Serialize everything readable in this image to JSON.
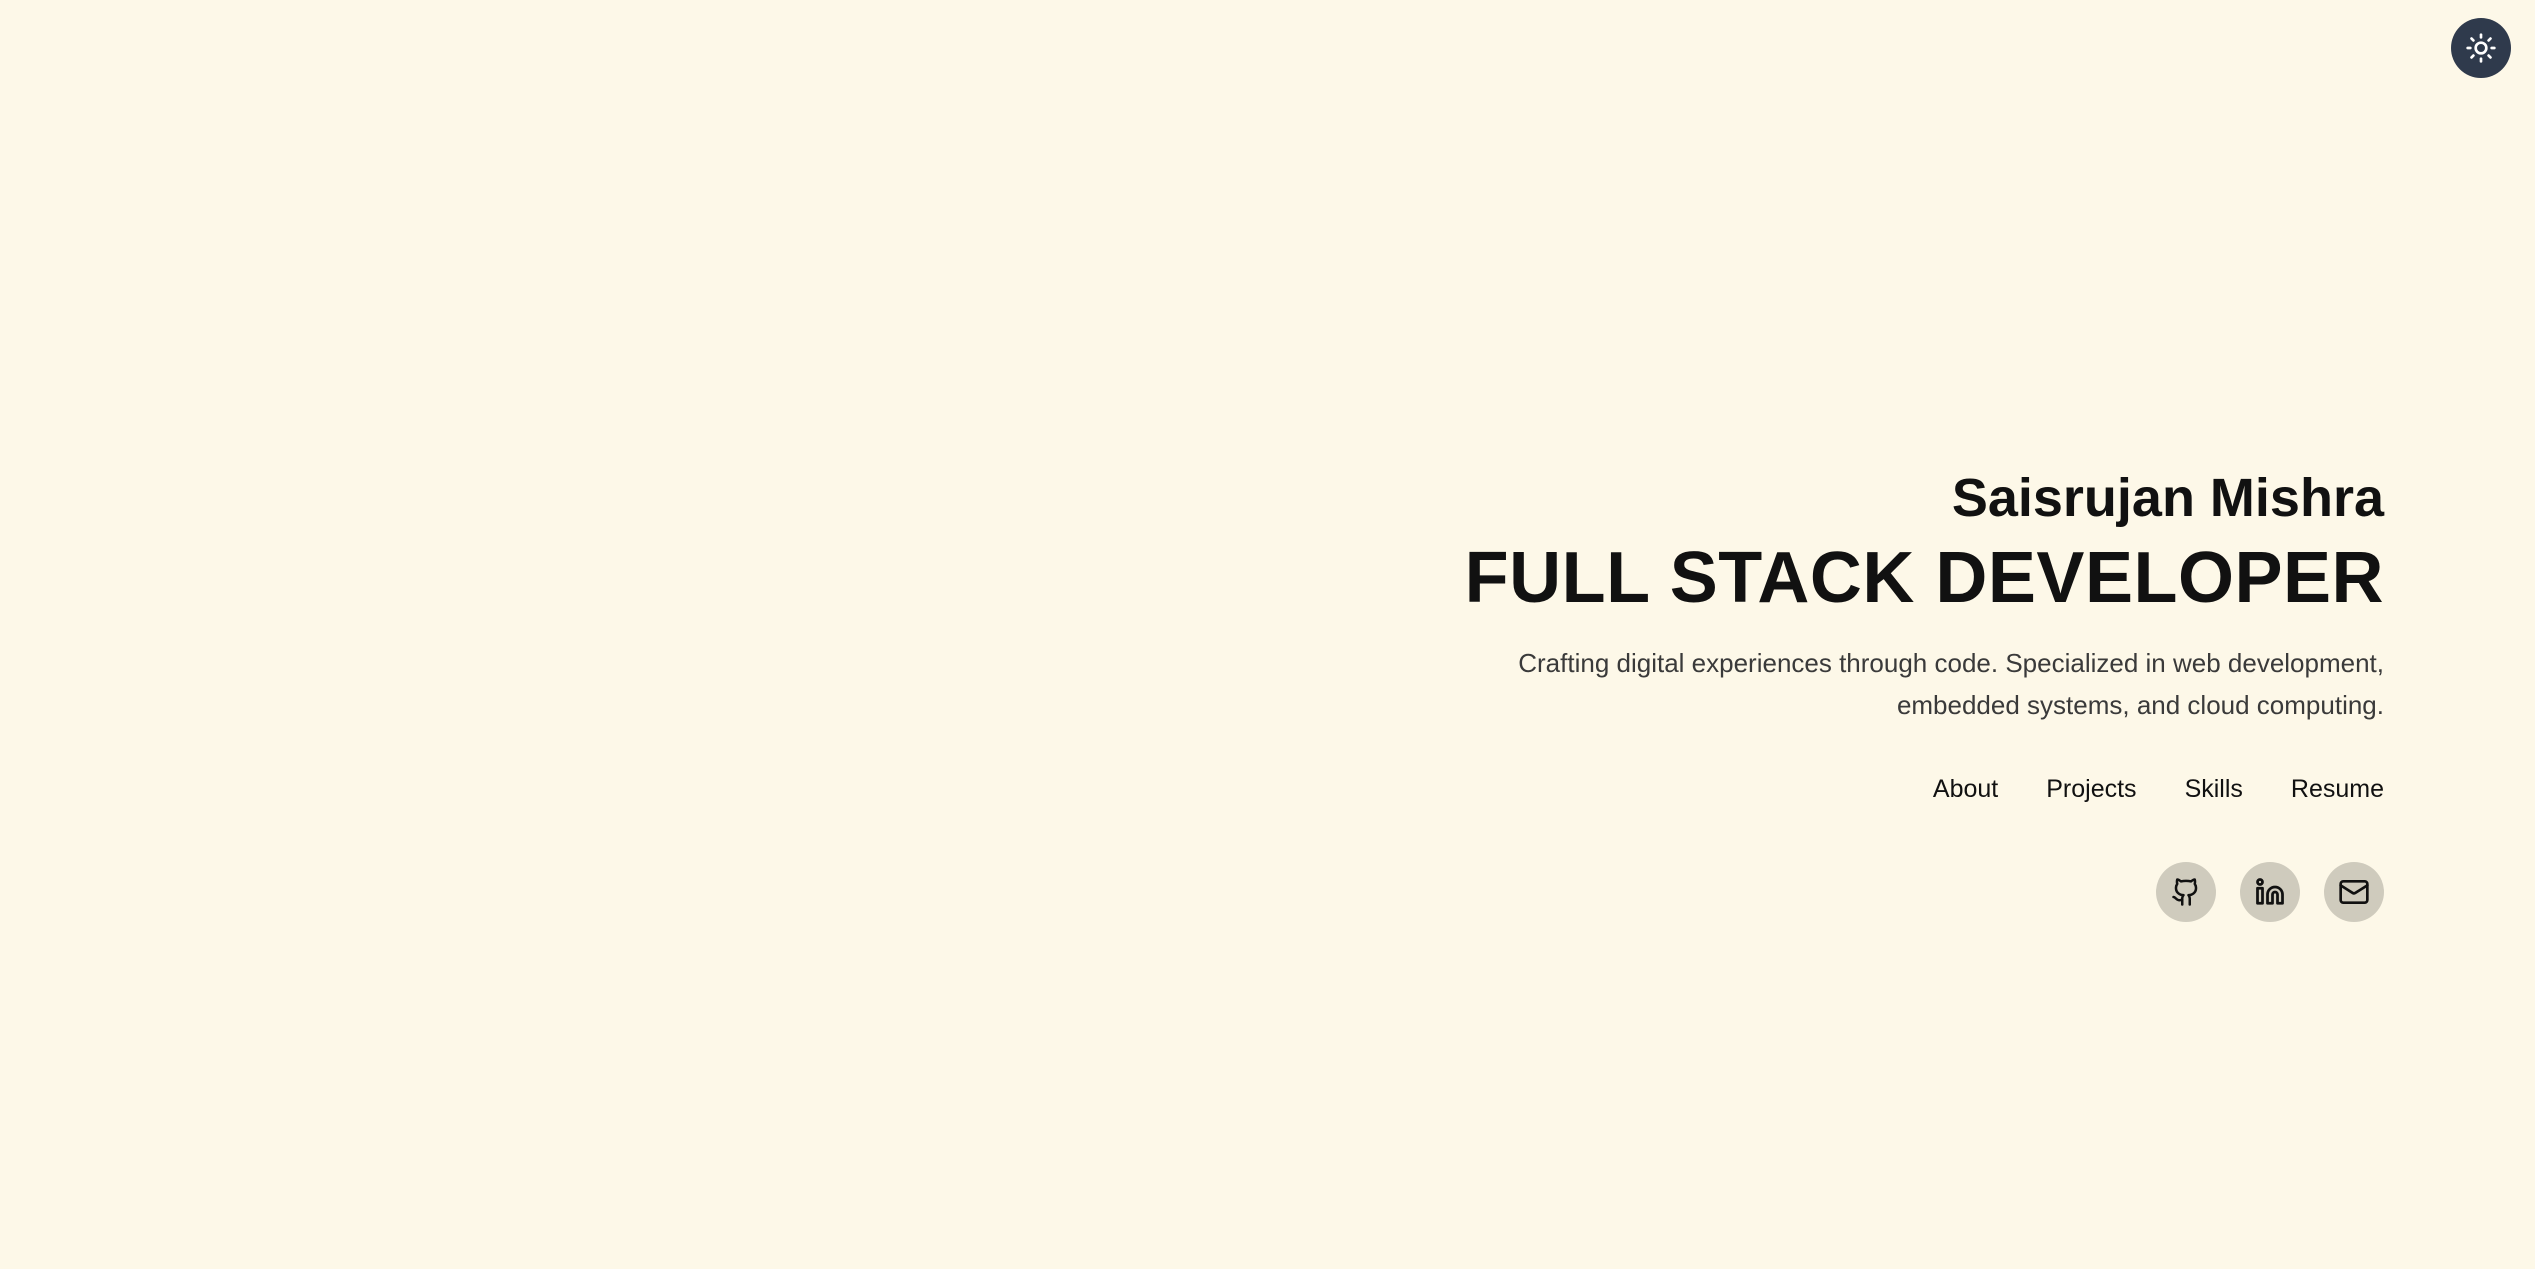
{
  "theme_toggle": {
    "icon": "sun-icon",
    "background": "#2f3a4c"
  },
  "hero": {
    "name": "Saisrujan Mishra",
    "role": "FULL STACK DEVELOPER",
    "tagline_line1": "Crafting digital experiences through code. Specialized in web development,",
    "tagline_line2": "embedded systems, and cloud computing."
  },
  "nav": {
    "items": [
      {
        "label": "About"
      },
      {
        "label": "Projects"
      },
      {
        "label": "Skills"
      },
      {
        "label": "Resume"
      }
    ]
  },
  "social": {
    "items": [
      {
        "icon": "github-icon"
      },
      {
        "icon": "linkedin-icon"
      },
      {
        "icon": "mail-icon"
      }
    ]
  },
  "colors": {
    "background": "#fdf8e8",
    "text": "#111111",
    "muted_text": "#3a3a3a",
    "social_bg": "#cfcbbd"
  }
}
